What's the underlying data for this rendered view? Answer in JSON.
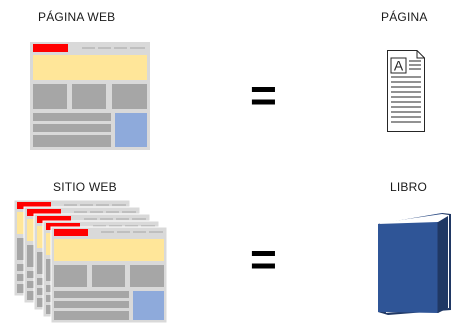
{
  "labels": {
    "web_page": "PÁGINA WEB",
    "page": "PÁGINA",
    "website": "SITIO WEB",
    "book": "LIBRO"
  },
  "equals_sign": "=",
  "icons": {
    "page_letter": "A"
  },
  "colors": {
    "header_red": "#ff0000",
    "banner_yellow": "#ffe699",
    "block_gray": "#a6a6a6",
    "frame_gray": "#d9d9d9",
    "accent_blue": "#8eaadb",
    "book_blue": "#2f5597",
    "book_dark": "#203864"
  }
}
